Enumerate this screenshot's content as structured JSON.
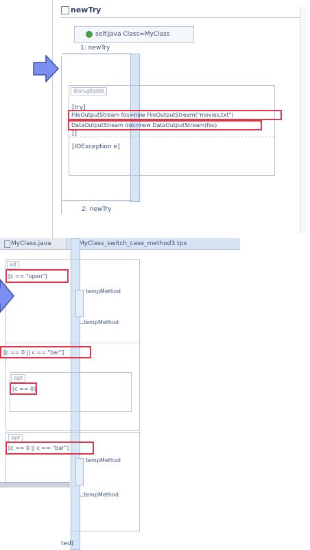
{
  "top_left_fragment": "*) ;",
  "top_diagram": {
    "title": "newTry",
    "lifeline_label": "self:Java Class=MyClass",
    "message_in": "1: newTry",
    "fragment_tag": "disruptable",
    "try_label": "[try]",
    "line1": "FileOutputStream fos=new FileOutputStream(\"movies.txt\")",
    "line2": "DataOutputStream dos=new DataOutputStream(fos)",
    "catch_sep": "[]",
    "catch_label": "[IOException e]",
    "message_out": "2: newTry"
  },
  "bottom_diagram": {
    "tab1": "MyClass.java",
    "tab2": "MyClass_switch_case_method3.tpx",
    "alt_tag": "alt",
    "cond1": "[c == \"open\"]",
    "call1": "tempMethod",
    "ret1": "tempMethod",
    "cond2": "[c == 0 || c == \"bar\"]",
    "opt_tag": "opt",
    "cond3": "[c == 0]",
    "loop_tag": "opt",
    "cond4": "[c == 0 || c == \"bar\"]",
    "call2": "tempMethod",
    "ret2": "tempMethod",
    "bottom_fragment": "ted)"
  },
  "colors": {
    "arrow": "#7b8ff0",
    "highlight": "#e0384a",
    "lifeline": "#d6e6f6"
  }
}
